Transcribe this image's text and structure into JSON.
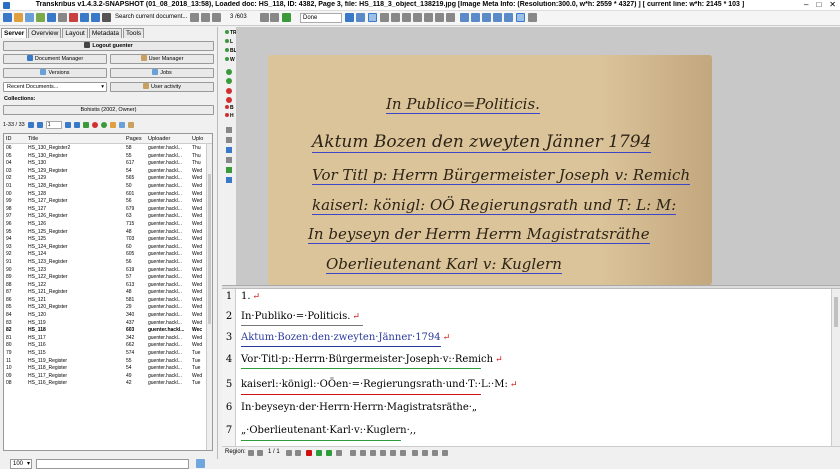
{
  "window": {
    "title": "Transkribus v1.4.3.2-SNAPSHOT (01_08_2018_13:58), Loaded doc: HS_118, ID: 4382, Page 3, file: HS_118_3_object_138219.jpg [Image Meta Info: (Resolution:300.0, w*h: 2559 * 4327) ] [ current line: w*h: 2145 * 103 ]"
  },
  "toolbar": {
    "search_placeholder": "Search current document...",
    "page_indicator": "3 /603",
    "status_select": "Done"
  },
  "left_panel": {
    "tabs": [
      {
        "label": "Server",
        "active": true
      },
      {
        "label": "Overview",
        "active": false
      },
      {
        "label": "Layout",
        "active": false
      },
      {
        "label": "Metadata",
        "active": false
      },
      {
        "label": "Tools",
        "active": false
      }
    ],
    "logout_label": "Logout guenter",
    "document_manager_label": "Document Manager",
    "user_manager_label": "User Manager",
    "versions_label": "Versions",
    "jobs_label": "Jobs",
    "recent_documents_label": "Recent Documents...",
    "user_activity_label": "User activity",
    "collections_label": "Collections:",
    "collection_value": "Bohistis (2002, Owner)",
    "pager": {
      "range": "1-33 / 33",
      "page": "1"
    },
    "table_headers": {
      "id": "ID",
      "title": "Title",
      "pages": "Pages",
      "uploader": "Uploader",
      "upload": "Uplo"
    },
    "rows": [
      {
        "id": "06",
        "title": "HS_130_Register2",
        "pages": "58",
        "uploader": "guenter.hackl...",
        "upload": "Thu"
      },
      {
        "id": "05",
        "title": "HS_130_Register",
        "pages": "55",
        "uploader": "guenter.hackl...",
        "upload": "Thu"
      },
      {
        "id": "04",
        "title": "HS_130",
        "pages": "617",
        "uploader": "guenter.hackl...",
        "upload": "Thu"
      },
      {
        "id": "03",
        "title": "HS_129_Register",
        "pages": "54",
        "uploader": "guenter.hackl...",
        "upload": "Wed"
      },
      {
        "id": "02",
        "title": "HS_129",
        "pages": "565",
        "uploader": "guenter.hackl...",
        "upload": "Wed"
      },
      {
        "id": "01",
        "title": "HS_128_Register",
        "pages": "50",
        "uploader": "guenter.hackl...",
        "upload": "Wed"
      },
      {
        "id": "00",
        "title": "HS_128",
        "pages": "601",
        "uploader": "guenter.hackl...",
        "upload": "Wed"
      },
      {
        "id": "99",
        "title": "HS_127_Register",
        "pages": "56",
        "uploader": "guenter.hackl...",
        "upload": "Wed"
      },
      {
        "id": "98",
        "title": "HS_127",
        "pages": "679",
        "uploader": "guenter.hackl...",
        "upload": "Wed"
      },
      {
        "id": "97",
        "title": "HS_126_Register",
        "pages": "63",
        "uploader": "guenter.hackl...",
        "upload": "Wed"
      },
      {
        "id": "96",
        "title": "HS_126",
        "pages": "715",
        "uploader": "guenter.hackl...",
        "upload": "Wed"
      },
      {
        "id": "95",
        "title": "HS_125_Register",
        "pages": "48",
        "uploader": "guenter.hackl...",
        "upload": "Wed"
      },
      {
        "id": "94",
        "title": "HS_125",
        "pages": "703",
        "uploader": "guenter.hackl...",
        "upload": "Wed"
      },
      {
        "id": "93",
        "title": "HS_124_Register",
        "pages": "60",
        "uploader": "guenter.hackl...",
        "upload": "Wed"
      },
      {
        "id": "92",
        "title": "HS_124",
        "pages": "605",
        "uploader": "guenter.hackl...",
        "upload": "Wed"
      },
      {
        "id": "91",
        "title": "HS_123_Register",
        "pages": "56",
        "uploader": "guenter.hackl...",
        "upload": "Wed"
      },
      {
        "id": "90",
        "title": "HS_123",
        "pages": "619",
        "uploader": "guenter.hackl...",
        "upload": "Wed"
      },
      {
        "id": "89",
        "title": "HS_122_Register",
        "pages": "57",
        "uploader": "guenter.hackl...",
        "upload": "Wed"
      },
      {
        "id": "88",
        "title": "HS_122",
        "pages": "613",
        "uploader": "guenter.hackl...",
        "upload": "Wed"
      },
      {
        "id": "87",
        "title": "HS_121_Register",
        "pages": "48",
        "uploader": "guenter.hackl...",
        "upload": "Wed"
      },
      {
        "id": "86",
        "title": "HS_121",
        "pages": "581",
        "uploader": "guenter.hackl...",
        "upload": "Wed"
      },
      {
        "id": "85",
        "title": "HS_120_Register",
        "pages": "29",
        "uploader": "guenter.hackl...",
        "upload": "Wed"
      },
      {
        "id": "84",
        "title": "HS_120",
        "pages": "340",
        "uploader": "guenter.hackl...",
        "upload": "Wed"
      },
      {
        "id": "83",
        "title": "HS_119",
        "pages": "437",
        "uploader": "guenter.hackl...",
        "upload": "Wed"
      },
      {
        "id": "82",
        "title": "HS_118",
        "pages": "603",
        "uploader": "guenter.hackl...",
        "upload": "Wec",
        "bold": true
      },
      {
        "id": "81",
        "title": "HS_117",
        "pages": "342",
        "uploader": "guenter.hackl...",
        "upload": "Wed"
      },
      {
        "id": "80",
        "title": "HS_116",
        "pages": "662",
        "uploader": "guenter.hackl...",
        "upload": "Wed"
      },
      {
        "id": "79",
        "title": "HS_115",
        "pages": "574",
        "uploader": "guenter.hackl...",
        "upload": "Tue"
      },
      {
        "id": "11",
        "title": "HS_119_Register",
        "pages": "55",
        "uploader": "guenter.hackl...",
        "upload": "Tue"
      },
      {
        "id": "10",
        "title": "HS_118_Register",
        "pages": "54",
        "uploader": "guenter.hackl...",
        "upload": "Tue"
      },
      {
        "id": "09",
        "title": "HS_117_Register",
        "pages": "49",
        "uploader": "guenter.hackl...",
        "upload": "Wed"
      },
      {
        "id": "08",
        "title": "HS_116_Register",
        "pages": "42",
        "uploader": "guenter.hackl...",
        "upload": "Tue"
      }
    ],
    "page_size": "100"
  },
  "side_tools": [
    "TR",
    "L",
    "BL",
    "W",
    "B",
    "H"
  ],
  "image": {
    "lines": [
      "In Publico=Politicis.",
      "Aktum Bozen den zweyten Jänner 1794",
      "Vor Titl p: Herrn Bürgermeister Joseph v: Remich",
      "kaiserl: königl: OÖ Regierungsrath und T: L: M:",
      "In beyseyn der Herrn Herrn Magistratsräthe",
      "Oberlieutenant Karl v: Kuglern"
    ]
  },
  "transcription": {
    "lines": [
      {
        "num": "1",
        "text": "1.",
        "blue": false
      },
      {
        "num": "2",
        "text": "In·Publiko·=·Politicis.",
        "blue": false
      },
      {
        "num": "3",
        "text": "Aktum·Bozen·den·zweyten·Jänner·1794",
        "blue": true
      },
      {
        "num": "4",
        "text": "Vor·Titl·p:·Herrn·Bürgermeister·Joseph·v:·Remich",
        "blue": false
      },
      {
        "num": "5",
        "text": "kaiserl:·königl:·OÖen·=·Regierungsrath·und·T:·L:·M:",
        "blue": false
      },
      {
        "num": "6",
        "text": "In·beyseyn·der·Herrn·Herrn·Magistratsräthe·„",
        "blue": false
      },
      {
        "num": "7",
        "text": "„·Oberlieutenant·Karl·v:·Kuglern·,,",
        "blue": false
      }
    ],
    "return_glyph": "↵"
  },
  "bottom_bar": {
    "region_label": "Region:",
    "region_page": "1 / 1"
  }
}
